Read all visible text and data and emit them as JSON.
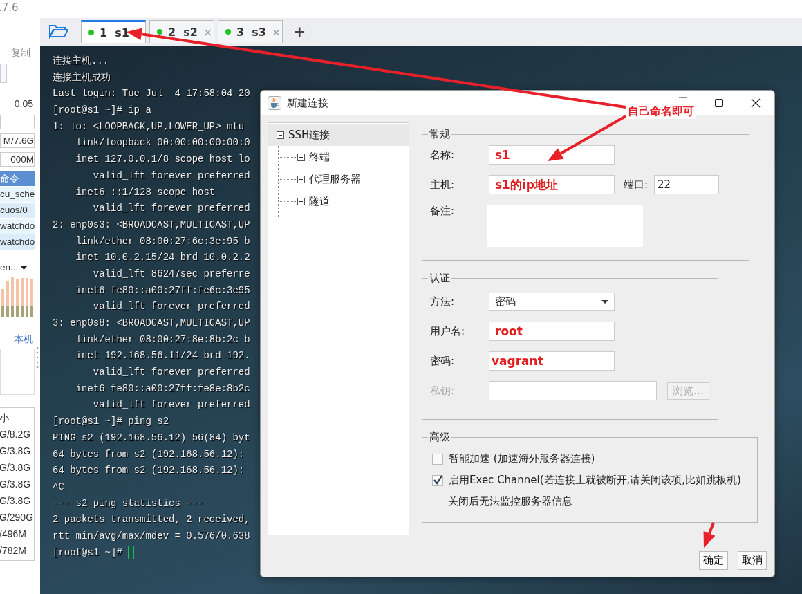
{
  "app_title": ".7.6",
  "sidebar": {
    "copy_label": "复制",
    "load": "0.05",
    "memory": "M/7.6G",
    "swap": "000M",
    "process_header": "命令",
    "processes": [
      "cu_sche",
      "cuos/0",
      "watchdo",
      "watchdo"
    ],
    "network_select": "en...",
    "network_label": "本机",
    "disk_header": "小",
    "disks": [
      "G/8.2G",
      "G/3.8G",
      "G/3.8G",
      "G/3.8G",
      "G/3.8G",
      "G/290G",
      "/496M",
      "/782M"
    ]
  },
  "tabs": [
    {
      "label": "1  s1",
      "selected": true
    },
    {
      "label": "2  s2",
      "selected": false,
      "close": "×"
    },
    {
      "label": "3  s3",
      "selected": false,
      "close": "×"
    }
  ],
  "new_tab": "+",
  "terminal": {
    "lines": [
      "连接主机...",
      "连接主机成功",
      "Last login: Tue Jul  4 17:58:04 20",
      "[root@s1 ~]# ip a",
      "1: lo: <LOOPBACK,UP,LOWER_UP> mtu",
      "    link/loopback 00:00:00:00:00:0",
      "    inet 127.0.0.1/8 scope host lo",
      "       valid_lft forever preferred",
      "    inet6 ::1/128 scope host",
      "       valid_lft forever preferred",
      "2: enp0s3: <BROADCAST,MULTICAST,UP",
      "    link/ether 08:00:27:6c:3e:95 b",
      "    inet 10.0.2.15/24 brd 10.0.2.2",
      "       valid_lft 86247sec preferre",
      "    inet6 fe80::a00:27ff:fe6c:3e95",
      "       valid_lft forever preferred",
      "3: enp0s8: <BROADCAST,MULTICAST,UP",
      "    link/ether 08:00:27:8e:8b:2c b",
      "    inet 192.168.56.11/24 brd 192.",
      "       valid_lft forever preferred",
      "    inet6 fe80::a00:27ff:fe8e:8b2c",
      "       valid_lft forever preferred",
      "[root@s1 ~]# ping s2",
      "PING s2 (192.168.56.12) 56(84) byt",
      "64 bytes from s2 (192.168.56.12):",
      "64 bytes from s2 (192.168.56.12):",
      "^C",
      "--- s2 ping statistics ---",
      "2 packets transmitted, 2 received,",
      "rtt min/avg/max/mdev = 0.576/0.638",
      "[root@s1 ~]#"
    ]
  },
  "dialog": {
    "title": "新建连接",
    "tree": {
      "label": "SSH连接",
      "selected": true,
      "expanded": true,
      "children": [
        {
          "label": "终端",
          "selected": false
        },
        {
          "label": "代理服务器",
          "selected": false
        },
        {
          "label": "隧道",
          "selected": false
        }
      ]
    },
    "general": {
      "legend": "常规",
      "name_label": "名称:",
      "name_value": "s1",
      "host_label": "主机:",
      "host_value": "s1的ip地址",
      "port_label": "端口:",
      "port_value": "22",
      "note_label": "备注:"
    },
    "auth": {
      "legend": "认证",
      "method_label": "方法:",
      "method_value": "密码",
      "user_label": "用户名:",
      "user_value": "root",
      "password_label": "密码:",
      "password_value": "vagrant",
      "key_label": "私钥:",
      "key_disabled": true,
      "browse_button": "浏览..."
    },
    "advanced": {
      "legend": "高级",
      "options": [
        {
          "label": "智能加速 (加速海外服务器连接)",
          "checked": false
        },
        {
          "label": "启用Exec Channel(若连接上就被断开,请关闭该项,比如跳板机)",
          "checked": true,
          "note": "关闭后无法监控服务器信息"
        }
      ]
    },
    "buttons": [
      "确定",
      "取消"
    ]
  },
  "annotation": {
    "note": "自己命名即可"
  }
}
